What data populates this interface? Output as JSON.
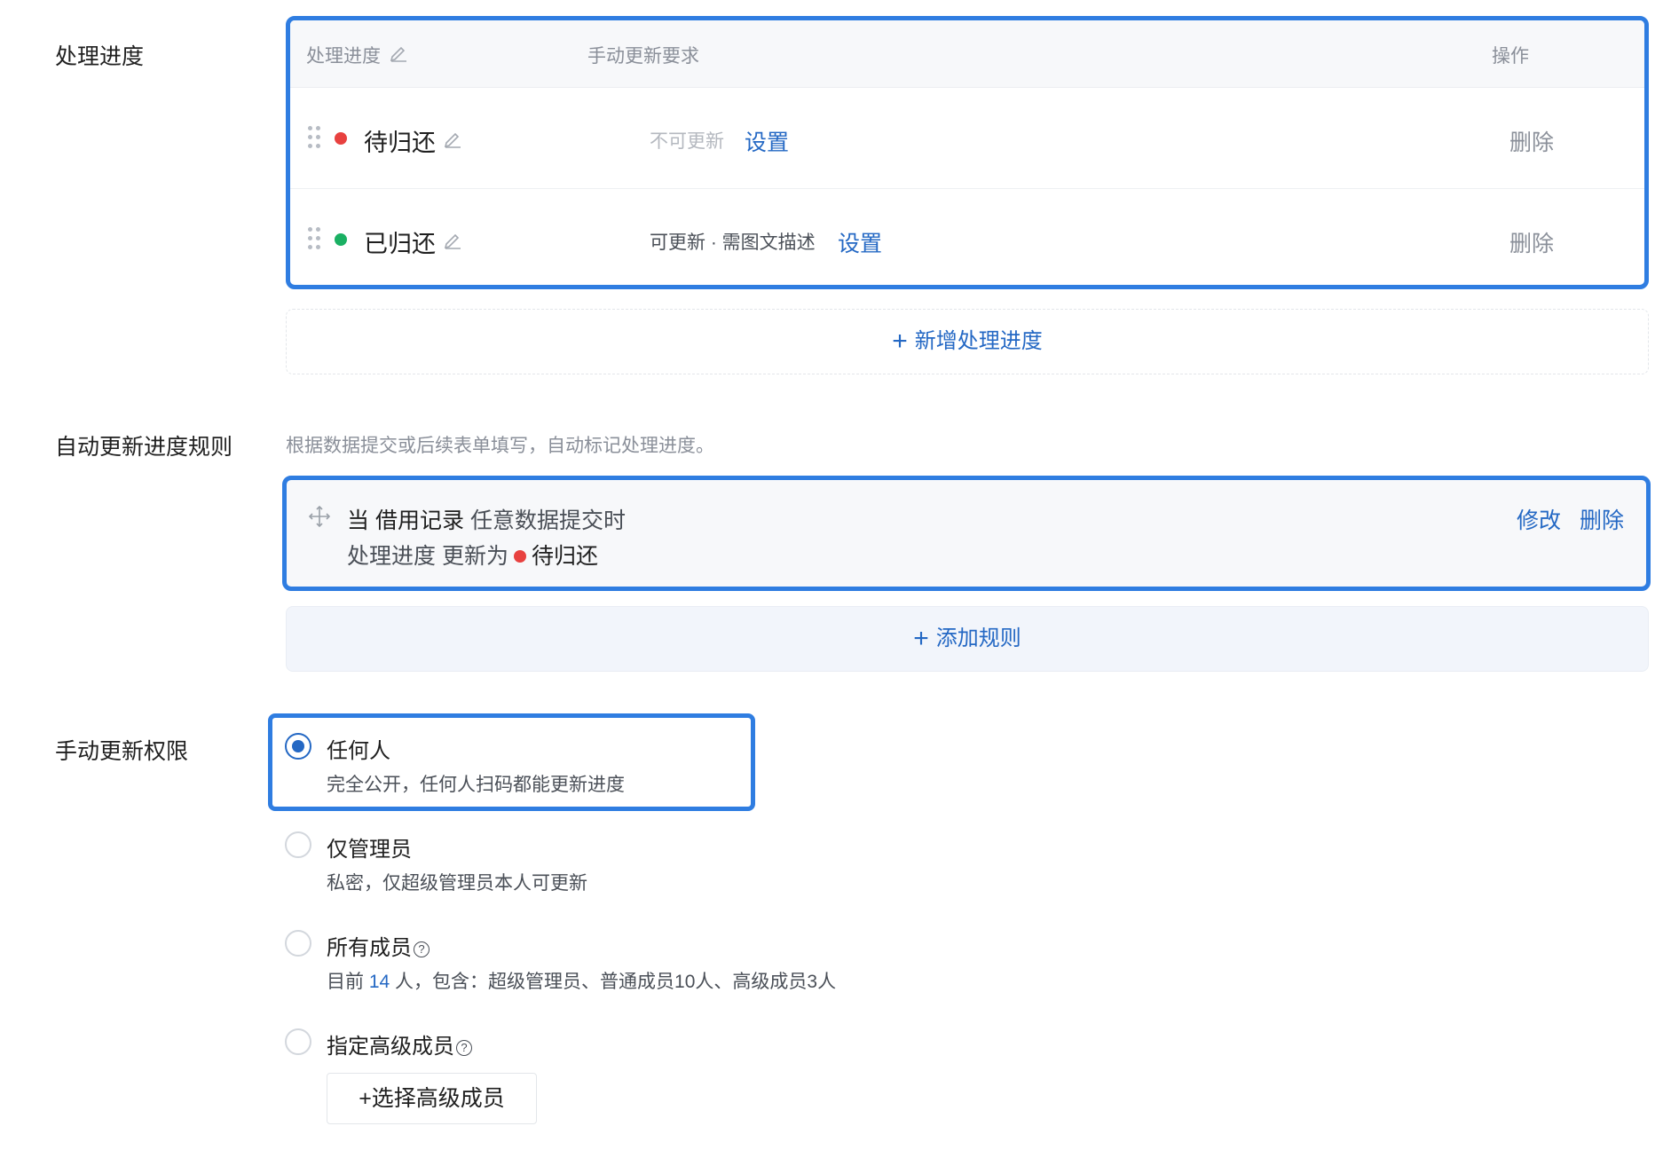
{
  "progress_section": {
    "label": "处理进度",
    "table": {
      "headers": {
        "status": "处理进度",
        "requirement": "手动更新要求",
        "action": "操作"
      },
      "rows": [
        {
          "status": "待归还",
          "status_color": "#e8413f",
          "requirement": "不可更新",
          "set_label": "设置",
          "delete_label": "删除"
        },
        {
          "status": "已归还",
          "status_color": "#1ab063",
          "requirement": "可更新 · 需图文描述",
          "set_label": "设置",
          "delete_label": "删除"
        }
      ]
    },
    "add_label": "新增处理进度"
  },
  "auto_rule_section": {
    "label": "自动更新进度规则",
    "description": "根据数据提交或后续表单填写，自动标记处理进度。",
    "rule": {
      "prefix": "当",
      "form_name": "借用记录",
      "trigger": "任意数据提交时",
      "field": "处理进度",
      "update_to": "更新为",
      "status": "待归还",
      "edit_label": "修改",
      "delete_label": "删除"
    },
    "add_label": "添加规则"
  },
  "permission_section": {
    "label": "手动更新权限",
    "options": [
      {
        "title": "任何人",
        "desc": "完全公开，任何人扫码都能更新进度",
        "checked": true
      },
      {
        "title": "仅管理员",
        "desc": "私密，仅超级管理员本人可更新",
        "checked": false
      },
      {
        "title": "所有成员",
        "desc_prefix": "目前",
        "count": "14",
        "desc_suffix": "人，包含：超级管理员、普通成员10人、高级成员3人",
        "checked": false
      },
      {
        "title": "指定高级成员",
        "checked": false
      }
    ],
    "select_members_label": "+选择高级成员"
  },
  "colors": {
    "accent": "#2468c4",
    "highlight_border": "#2f7de1",
    "red": "#e8413f",
    "green": "#1ab063"
  }
}
